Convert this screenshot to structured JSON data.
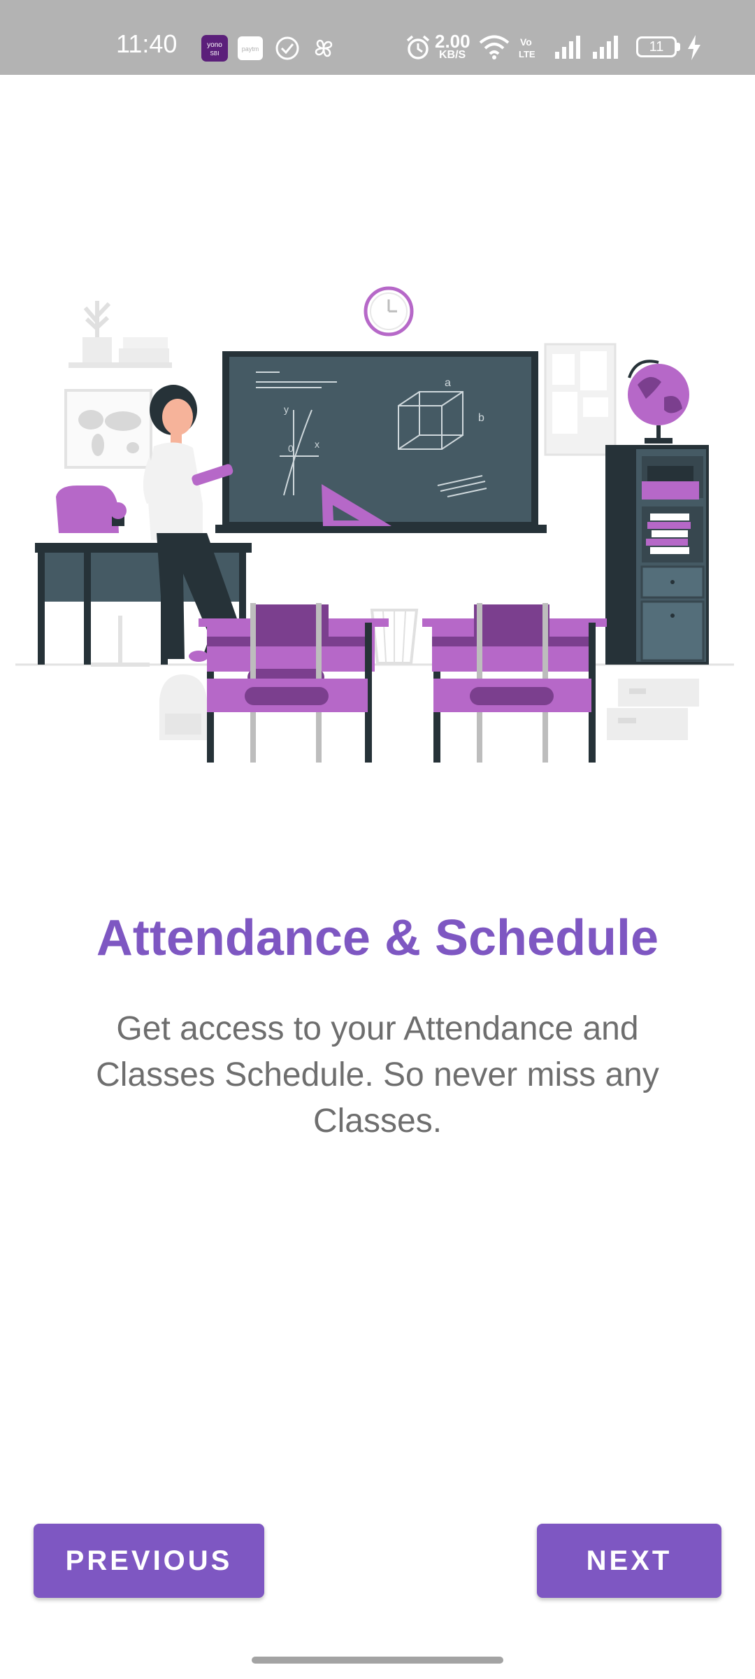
{
  "status_bar": {
    "time": "11:40",
    "network_speed_value": "2.00",
    "network_speed_unit": "KB/S",
    "battery_level": "11",
    "volte_label": "Vo\nLTE",
    "notification_icons": [
      "yono-sbi-icon",
      "paytm-icon",
      "check-circle-icon",
      "pinwheel-icon"
    ],
    "system_icons": [
      "alarm-icon",
      "wifi-icon",
      "volte-icon",
      "signal-icon",
      "signal-icon",
      "battery-icon",
      "charging-icon"
    ]
  },
  "onboarding": {
    "illustration": "classroom-teacher-illustration",
    "title": "Attendance & Schedule",
    "description": "Get access to your Attendance and Classes Schedule. So never miss any Classes."
  },
  "buttons": {
    "previous_label": "PREVIOUS",
    "next_label": "NEXT"
  },
  "colors": {
    "accent": "#7e57c2",
    "status_bar": "#b3b3b3",
    "illustration_purple": "#b668c8",
    "board": "#455a64",
    "text_secondary": "#6e6e6e"
  }
}
